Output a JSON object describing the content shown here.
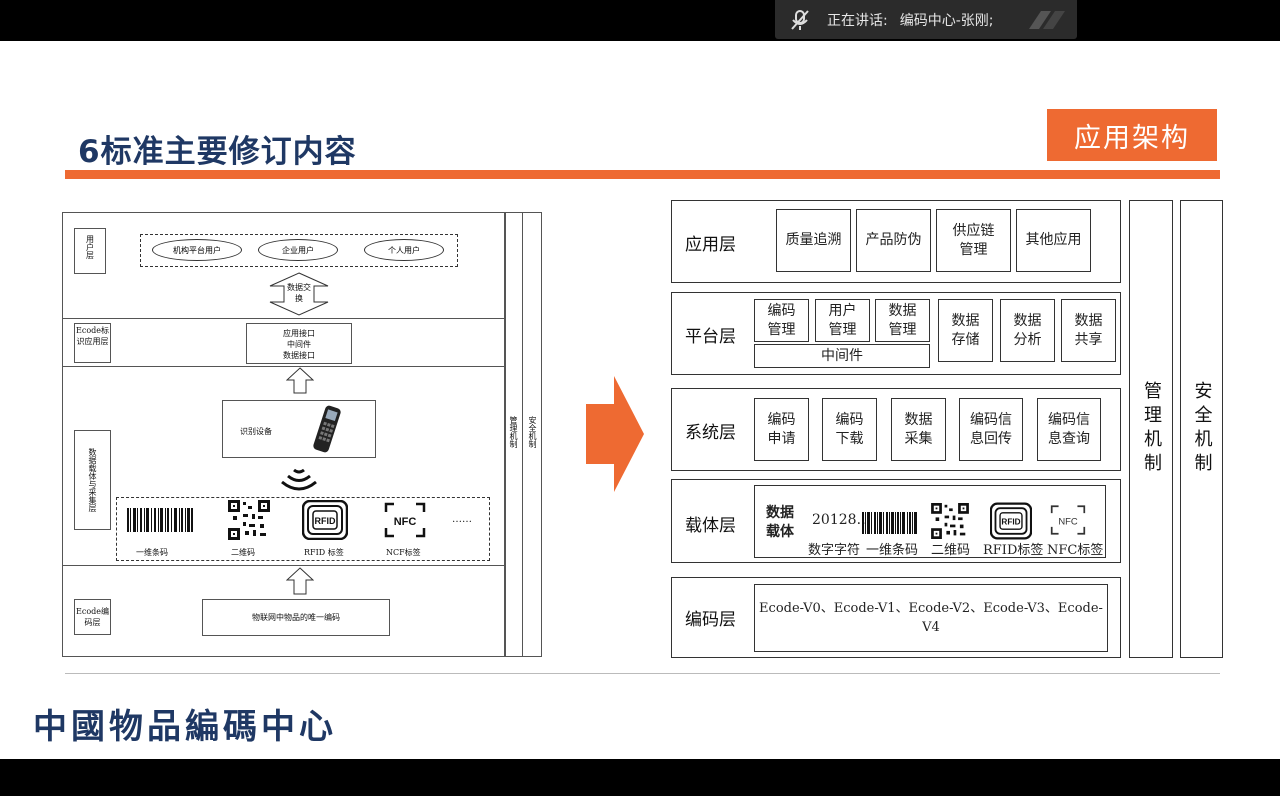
{
  "meeting": {
    "speaking_label": "正在讲话:",
    "speaker_name": "编码中心-张刚;"
  },
  "slide": {
    "title": "6标准主要修订内容",
    "badge": "应用架构",
    "logo": "中國物品編碼中心"
  },
  "left_diagram": {
    "user_layer": "用户层",
    "users": [
      "机构平台用户",
      "企业用户",
      "个人用户"
    ],
    "data_exchange": "数据交换",
    "ecode_app_layer": "Ecode标识应用层",
    "interfaces": [
      "应用接口",
      "中间件",
      "数据接口"
    ],
    "carrier_layer": "数据载体与采集层",
    "reader": "识别设备",
    "carriers": [
      "一维条码",
      "二维码",
      "RFID 标签",
      "NCF标签"
    ],
    "ellipsis": "……",
    "ecode_code_layer": "Ecode编码层",
    "unique_code": "物联网中物品的唯一编码",
    "mgmt": "管理机制",
    "security": "安全机制",
    "rfid_text": "RFID",
    "nfc_text": "NFC"
  },
  "right_diagram": {
    "layers": {
      "app": "应用层",
      "platform": "平台层",
      "system": "系统层",
      "carrier": "载体层",
      "coding": "编码层"
    },
    "app_items": [
      "质量追溯",
      "产品防伪",
      "供应链管理",
      "其他应用"
    ],
    "platform_items": [
      "编码管理",
      "用户管理",
      "数据管理"
    ],
    "middleware": "中间件",
    "platform_data": [
      "数据存储",
      "数据分析",
      "数据共享"
    ],
    "system_items": [
      "编码申请",
      "编码下载",
      "数据采集",
      "编码信息回传",
      "编码信息查询"
    ],
    "carrier_label": "数据载体",
    "digits": "20128…",
    "carrier_captions": [
      "数字字符",
      "一维条码",
      "二维码",
      "RFID标签",
      "NFC标签"
    ],
    "coding_text": "Ecode-V0、Ecode-V1、Ecode-V2、Ecode-V3、Ecode-V4",
    "mgmt": "管理机制",
    "security": "安全机制",
    "rfid_text": "RFID",
    "nfc_text": "NFC"
  }
}
